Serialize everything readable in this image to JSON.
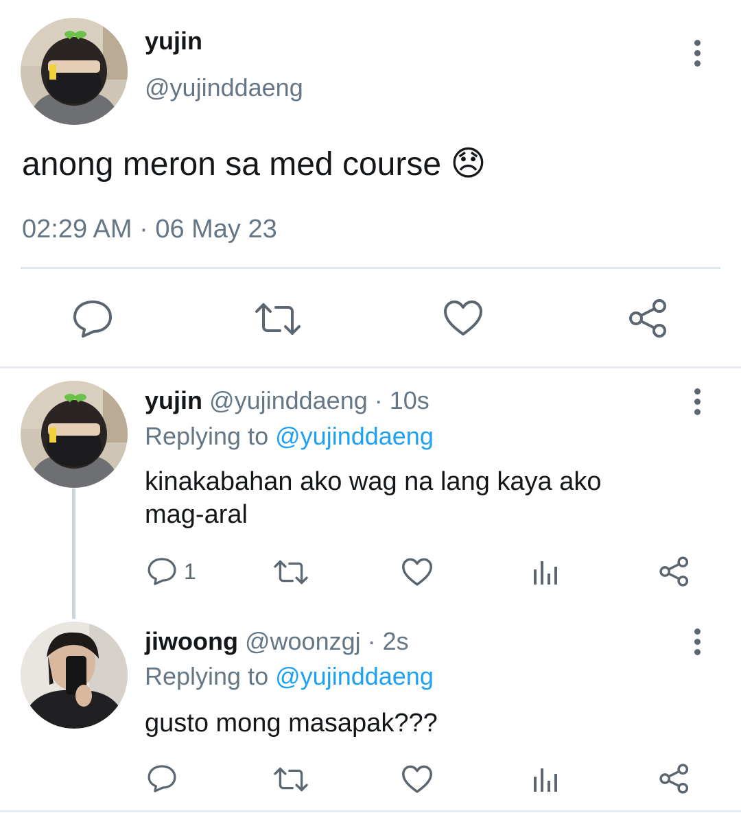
{
  "main_tweet": {
    "display_name": "yujin",
    "handle": "@yujinddaeng",
    "text": "anong meron sa med course",
    "emoji": "😞",
    "timestamp": "02:29 AM · 06 May 23",
    "actions": [
      "reply-icon",
      "retweet-icon",
      "like-icon",
      "share-icon"
    ]
  },
  "replies": [
    {
      "display_name": "yujin",
      "handle": "@yujinddaeng",
      "time": "· 10s",
      "replying_prefix": "Replying to",
      "replying_to": "@yujinddaeng",
      "text_line1": "kinakabahan ako wag na lang kaya ako",
      "text_line2": "mag-aral",
      "reply_count": "1"
    },
    {
      "display_name": "jiwoong",
      "handle": "@woonzgj",
      "time": "· 2s",
      "replying_prefix": "Replying to",
      "replying_to": "@yujinddaeng",
      "text_line1": "gusto mong masapak???",
      "text_line2": "",
      "reply_count": ""
    }
  ],
  "colors": {
    "link": "#1da1f2",
    "secondary_text": "#657786",
    "icon": "#5b6670",
    "divider": "#e1e8ed"
  }
}
